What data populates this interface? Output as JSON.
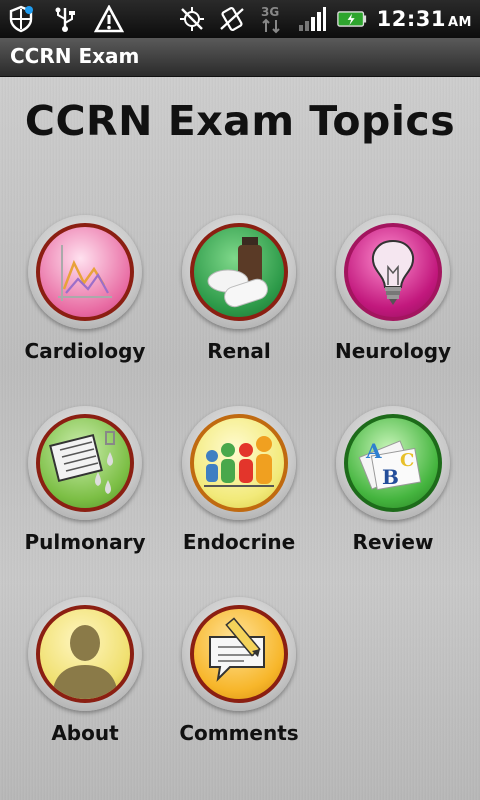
{
  "status_bar": {
    "time": "12:31",
    "ampm": "AM",
    "network": "3G",
    "icons": [
      "shield-icon",
      "usb-icon",
      "warning-icon",
      "gps-off-icon",
      "rotate-icon",
      "3g-icon",
      "signal-icon",
      "battery-icon"
    ]
  },
  "app": {
    "title": "CCRN Exam"
  },
  "page": {
    "heading": "CCRN Exam Topics"
  },
  "topics": [
    {
      "label": "Cardiology",
      "icon": "chart-icon",
      "color": "#e06ea0"
    },
    {
      "label": "Renal",
      "icon": "pills-icon",
      "color": "#2e9b4a"
    },
    {
      "label": "Neurology",
      "icon": "lightbulb-icon",
      "color": "#c2187d"
    },
    {
      "label": "Pulmonary",
      "icon": "document-droplets-icon",
      "color": "#7cbf45"
    },
    {
      "label": "Endocrine",
      "icon": "people-icon",
      "color": "#f2ea7a"
    },
    {
      "label": "Review",
      "icon": "abc-cards-icon",
      "color": "#45b53f"
    },
    {
      "label": "About",
      "icon": "person-silhouette-icon",
      "color": "#f0e070"
    },
    {
      "label": "Comments",
      "icon": "speech-bubble-pencil-icon",
      "color": "#f7b62a"
    }
  ]
}
